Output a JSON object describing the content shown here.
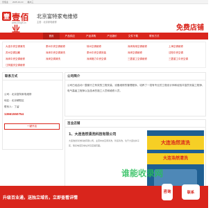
{
  "topbar": {
    "site": "壹佰业",
    "date": "2025-10-10",
    "location": "福州三"
  },
  "header": {
    "logo_glyph": "壹",
    "logo_text": "壹佰业",
    "logo_url": "www.100ye.cn",
    "company": "北京富特家电维修",
    "company_sub": "主营：北京家电维修",
    "free_shop": "免费店铺"
  },
  "nav": [
    "首页",
    "产品供应",
    "产品求购",
    "产品报价",
    "文件下载",
    "联系方式"
  ],
  "services": [
    "大连中央空调清洗",
    "泰州中央空调维修",
    "徐州空调维修",
    "深圳商用空调维修",
    "上海空调维修",
    "苏州空调加氟",
    "深圳中央空调清洗",
    "泰州中央空调安装",
    "深圳空调维修",
    "沈阳中央空调",
    "深圳中央空调维修",
    "深圳空调清洗",
    "深圳格力中央空调",
    "三菱重工空调维修",
    "三菱重工中央空调",
    "江阴重庆空调维修"
  ],
  "contact": {
    "title": "联系方式",
    "company_label": "公司：北京富特家电维修",
    "city_label": "地区：北京朝阳区",
    "person_label": "联系人：丁留",
    "phone": "13661550754",
    "consult_button": "一键开店"
  },
  "intro": {
    "title": "公司简介",
    "text": "公司已经启动一整套行之有效的工程安装、设备维修的管理程序，培养了一批有专业的工程设计师和经验丰富的安装工程师、电气高级工程师以及技术的施工人员和维修人员。"
  },
  "shop": {
    "title": "百业店铺",
    "item_title": "1、大连浩然清洗科技有限公司",
    "item_desc": "大连浩然清洗科技有限公司，主营中央空调清洗、管道清洗，位于大连甘井子区，联系电话及地址详见店铺页面。",
    "ad_line1": "大连浩然清洗",
    "ad_line2": "大连浩然清洗"
  },
  "bottom": {
    "text": "升级百业通，送独立域名，立即查看详情",
    "fab1": "咨询",
    "fab2": "联系"
  },
  "watermark": {
    "line1": "谁能收录网",
    "line2": ""
  }
}
